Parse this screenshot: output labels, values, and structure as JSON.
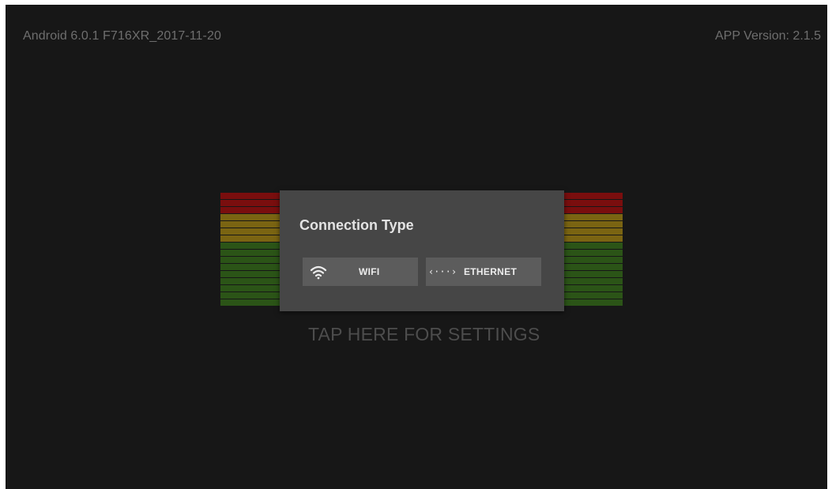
{
  "status_bar": {
    "system_info": "Android 6.0.1 F716XR_2017-11-20",
    "app_version": "APP Version: 2.1.5"
  },
  "meters": {
    "segment_colors": [
      "#7a0e0e",
      "#7a0e0e",
      "#7a0e0e",
      "#7a6412",
      "#7a6412",
      "#7a6412",
      "#7a6412",
      "#2b5417",
      "#2b5417",
      "#2b5417",
      "#2b5417",
      "#2b5417",
      "#2b5417",
      "#2b5417",
      "#2b5417",
      "#2b5417"
    ],
    "colors": {
      "red": "#7a0e0e",
      "yellow": "#7a6412",
      "green": "#2b5417"
    }
  },
  "dialog": {
    "title": "Connection Type",
    "buttons": [
      {
        "label": "WIFI",
        "icon": "wifi-icon"
      },
      {
        "label": "ETHERNET",
        "icon": "ethernet-icon",
        "icon_glyph": "‹···›"
      }
    ]
  },
  "settings_prompt": "TAP HERE FOR SETTINGS",
  "colors": {
    "background": "#171717",
    "dialog": "#464646",
    "button": "#5c5c5c"
  }
}
